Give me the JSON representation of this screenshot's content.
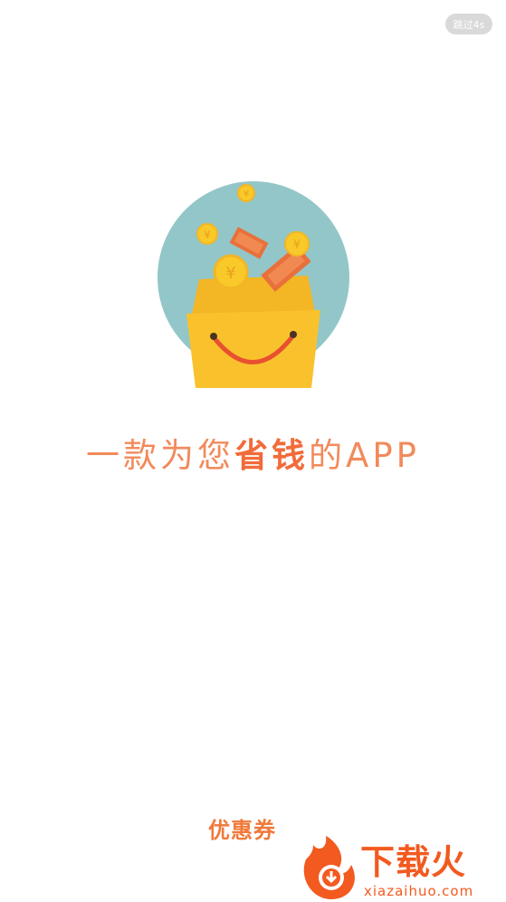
{
  "skip": {
    "label": "跳过4s"
  },
  "slogan": {
    "prefix": "一款为您",
    "highlight": "省钱",
    "suffix": "的APP"
  },
  "brand": {
    "name": "优惠券"
  },
  "watermark": {
    "name": "下载火",
    "url": "xiazaihuo.com"
  },
  "hero": {
    "coin_symbol": "¥"
  },
  "colors": {
    "circle": "#93c6c8",
    "bag": "#f7c42f",
    "accent": "#f28a5b",
    "watermark": "#f25a1f"
  }
}
